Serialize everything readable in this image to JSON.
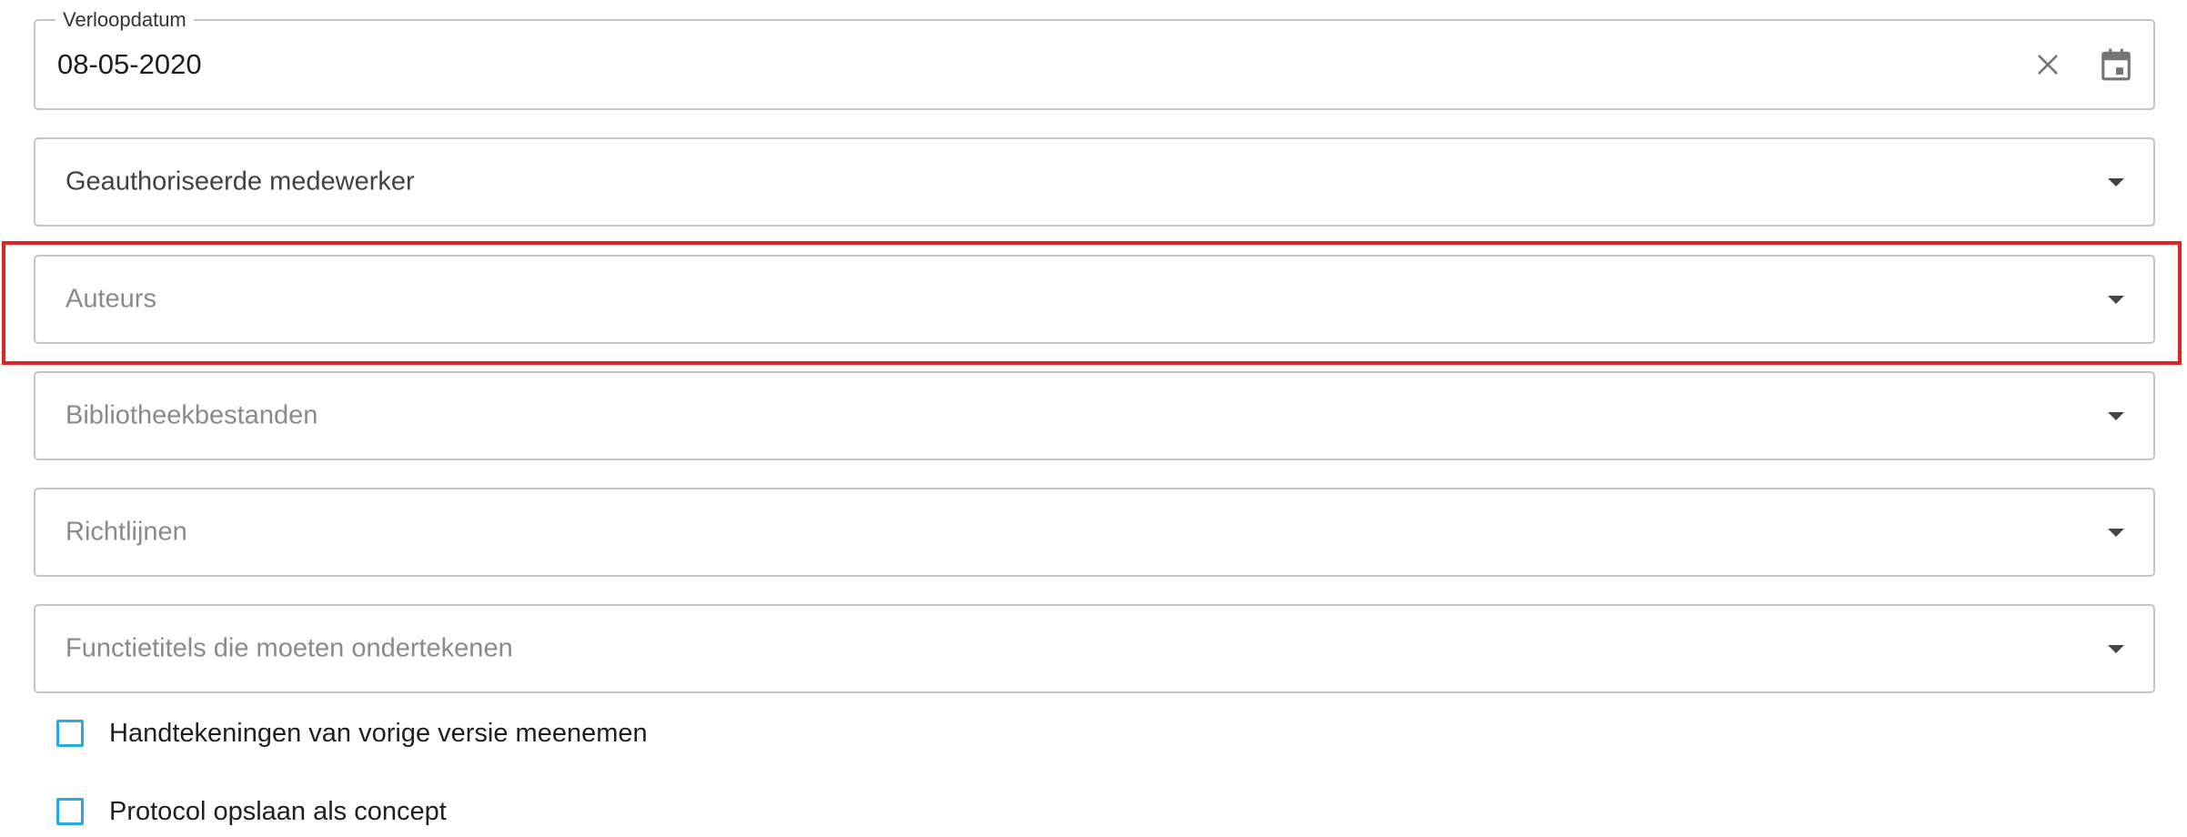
{
  "expiry_date": {
    "label": "Verloopdatum",
    "value": "08-05-2020"
  },
  "selects": [
    {
      "label": "Geauthoriseerde medewerker",
      "has_value": true
    },
    {
      "label": "Auteurs",
      "has_value": false,
      "highlighted": true
    },
    {
      "label": "Bibliotheekbestanden",
      "has_value": false
    },
    {
      "label": "Richtlijnen",
      "has_value": false
    },
    {
      "label": "Functietitels die moeten ondertekenen",
      "has_value": false
    }
  ],
  "checkboxes": [
    {
      "label": "Handtekeningen van vorige versie meenemen",
      "checked": false
    },
    {
      "label": "Protocol opslaan als concept",
      "checked": false
    }
  ],
  "colors": {
    "highlight": "#e02424",
    "checkbox_border": "#29a9e0",
    "field_border": "#c4c4c4"
  }
}
